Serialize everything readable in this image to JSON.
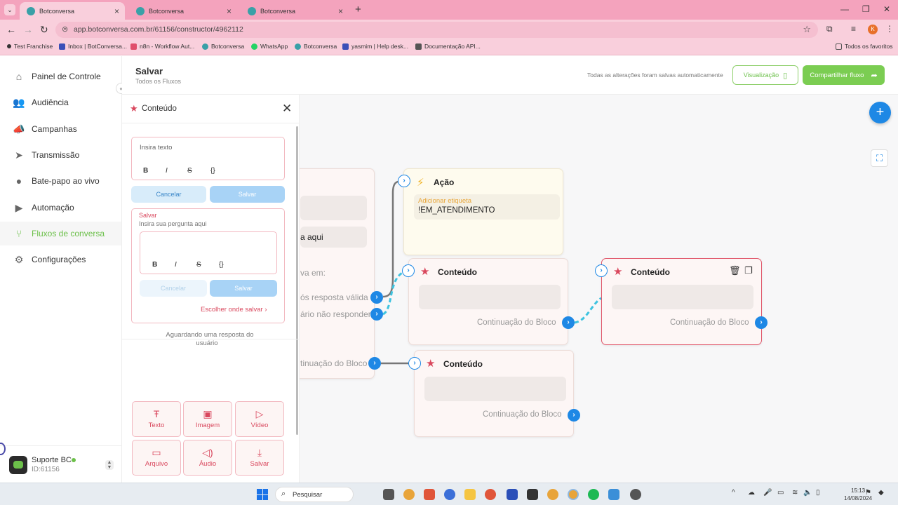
{
  "browser": {
    "tabs": [
      {
        "title": "Botconversa"
      },
      {
        "title": "Botconversa"
      },
      {
        "title": "Botconversa"
      }
    ],
    "url": "app.botconversa.com.br/61156/constructor/4962112",
    "profile_initial": "K",
    "bookmarks": [
      {
        "label": "Test Franchise",
        "icon": "pin-icon",
        "color": "#333333"
      },
      {
        "label": "Inbox | BotConversa...",
        "icon": "grid-icon",
        "color": "#3b4fb8"
      },
      {
        "label": "n8n - Workflow Aut...",
        "icon": "n8n-icon",
        "color": "#e04e6b"
      },
      {
        "label": "Botconversa",
        "icon": "botconversa-icon",
        "color": "#3aa0a7"
      },
      {
        "label": "WhatsApp",
        "icon": "whatsapp-icon",
        "color": "#25d366"
      },
      {
        "label": "Botconversa",
        "icon": "botconversa-icon",
        "color": "#3aa0a7"
      },
      {
        "label": "yasmim | Help desk...",
        "icon": "grid-icon",
        "color": "#3b4fb8"
      },
      {
        "label": "Documentação API...",
        "icon": "doc-icon",
        "color": "#555555"
      }
    ],
    "all_favorites": "Todos os favoritos"
  },
  "sidebar": {
    "items": [
      {
        "label": "Painel de Controle",
        "icon": "home-icon"
      },
      {
        "label": "Audiência",
        "icon": "users-icon"
      },
      {
        "label": "Campanhas",
        "icon": "megaphone-icon"
      },
      {
        "label": "Transmissão",
        "icon": "broadcast-icon"
      },
      {
        "label": "Bate-papo ao vivo",
        "icon": "chat-icon"
      },
      {
        "label": "Automação",
        "icon": "play-icon"
      },
      {
        "label": "Fluxos de conversa",
        "icon": "flow-icon"
      },
      {
        "label": "Configurações",
        "icon": "gear-icon"
      }
    ],
    "active_index": 6,
    "user": {
      "name": "Suporte BC",
      "id": "ID:61156"
    }
  },
  "header": {
    "title": "Salvar",
    "subtitle": "Todos os Fluxos",
    "status": "Todas as alterações foram salvas automaticamente",
    "preview_label": "Visualização",
    "share_label": "Compartilhar fluxo"
  },
  "panel": {
    "title": "Conteúdo",
    "box1": {
      "placeholder": "Insira texto",
      "cancel": "Cancelar",
      "save": "Salvar"
    },
    "box2": {
      "label": "Salvar",
      "question": "Insira sua pergunta aqui",
      "cancel": "Cancelar",
      "save": "Salvar",
      "choose": "Escolher onde salvar"
    },
    "format": {
      "bold": "B",
      "italic": "I",
      "strike": "S",
      "code": "{}"
    },
    "awaiting": "Aguardando uma resposta do usuário",
    "tiles": [
      {
        "label": "Texto",
        "icon": "text-icon"
      },
      {
        "label": "Imagem",
        "icon": "image-icon"
      },
      {
        "label": "Vídeo",
        "icon": "video-icon"
      },
      {
        "label": "Arquivo",
        "icon": "file-icon"
      },
      {
        "label": "Áudio",
        "icon": "audio-icon"
      },
      {
        "label": "Salvar",
        "icon": "save-icon"
      }
    ]
  },
  "canvas": {
    "partial_node": {
      "text_1": "a aqui",
      "text_2": "va em:",
      "option_1": "ós resposta válida",
      "option_2": "ário não responder",
      "continuation": "tinuação do Bloco"
    },
    "action_node": {
      "title": "Ação",
      "tag_label": "Adicionar etiqueta",
      "tag_value": "!EM_ATENDIMENTO"
    },
    "content_nodes": [
      {
        "title": "Conteúdo",
        "continuation": "Continuação do Bloco"
      },
      {
        "title": "Conteúdo",
        "continuation": "Continuação do Bloco"
      },
      {
        "title": "Conteúdo",
        "continuation": "Continuação do Bloco"
      }
    ]
  },
  "taskbar": {
    "search": "Pesquisar",
    "time": "15:13",
    "date": "14/08/2024"
  }
}
